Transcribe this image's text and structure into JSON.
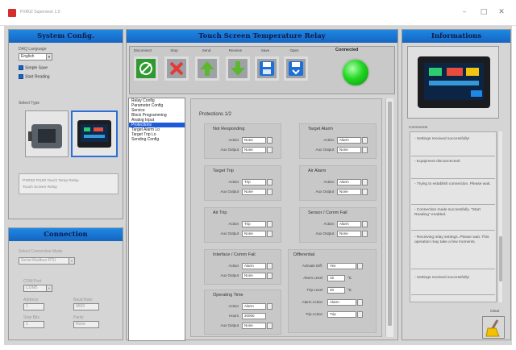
{
  "window": {
    "title": "PXR02 Supervisor 1.0",
    "minimize": "–",
    "maximize": "□",
    "close": "✕"
  },
  "system_config": {
    "header": "System Config.",
    "language_label": "DAQ Language",
    "language_value": "English",
    "simple_save": "Simple Save",
    "start_reading": "Start Reading",
    "select_type_label": "Select Type",
    "device_info_line1": "PXR02 Pt100 Touch Temp Relay",
    "device_info_line2": "Touch Screen Relay"
  },
  "connection": {
    "header": "Connection",
    "com_label": "Select Connection Mode",
    "com_value": "Serial Modbus RTU",
    "port_label": "COM Port",
    "port_value": "COM5",
    "addr_label": "Address",
    "addr_value": "1",
    "baud_label": "Baud Rate",
    "baud_value": "9600",
    "parity_label": "Parity",
    "parity_value": "None",
    "stop_label": "Stop Bits",
    "stop_value": "1"
  },
  "relay": {
    "header": "Touch Screen Temperature Relay",
    "toolbar": [
      {
        "label": "Disconnect"
      },
      {
        "label": "Stop"
      },
      {
        "label": "Send"
      },
      {
        "label": "Receive"
      },
      {
        "label": "Save"
      },
      {
        "label": "Open"
      }
    ],
    "connected_label": "Connected",
    "tree": [
      "Relay Config",
      "Parameter Config",
      "Service",
      "Block Programming",
      "Analog Input",
      "Protections",
      "Target Alarm Lo",
      "Target Trip Lo",
      "Sending Config"
    ],
    "tree_selected_index": 5,
    "section_title": "Protections 1/2",
    "groups": {
      "not_responding": {
        "title": "Not Responding",
        "action_label": "Action",
        "action": "None",
        "aux_label": "Aux Output",
        "aux": "None"
      },
      "target_alarm": {
        "title": "Target Alarm",
        "action_label": "Action",
        "action": "Alarm",
        "aux_label": "Aux Output",
        "aux": "None"
      },
      "target_trip": {
        "title": "Target Trip",
        "action_label": "Action",
        "action": "Trip",
        "aux_label": "Aux Output",
        "aux": "None"
      },
      "air_alarm": {
        "title": "Air Alarm",
        "action_label": "Action",
        "action": "Alarm",
        "aux_label": "Aux Output",
        "aux": "None"
      },
      "air_trip": {
        "title": "Air Trip",
        "action_label": "Action",
        "action": "Trip",
        "aux_label": "Aux Output",
        "aux": "None"
      },
      "sensor_fail": {
        "title": "Sensor / Comm Fail",
        "action_label": "Action",
        "action": "Alarm",
        "aux_label": "Aux Output",
        "aux": "None"
      },
      "interface_fail": {
        "title": "Interface / Comm Fail",
        "action_label": "Action",
        "action": "Alarm",
        "aux_label": "Aux Output",
        "aux": "None"
      },
      "differential": {
        "title": "Differential",
        "activate_label": "Activate Diff.",
        "activate": "Yes",
        "alarm_label": "Alarm Level",
        "alarm": "15",
        "trip_label": "Trip Level",
        "trip": "20",
        "alarm_action_label": "Alarm Action",
        "alarm_action": "Alarm",
        "trip_action_label": "Trip Action",
        "trip_action": "Trip",
        "unit": "°C"
      },
      "operating_time": {
        "title": "Operating Time",
        "action_label": "Action",
        "action": "Alarm",
        "hours_label": "Hours",
        "hours": "20000",
        "aux_label": "Aux Output",
        "aux": "None"
      }
    }
  },
  "informations": {
    "header": "Informations",
    "log_label": "Comments",
    "messages": [
      "- Settings received successfully!",
      "- Equipment disconnected!",
      "- Trying to establish connection. Please wait.",
      "- Connection made successfully. \"Start Reading\" enabled.",
      "- Receiving relay settings. Please wait. This operation may take a few moments.",
      "- Settings received successfully!"
    ],
    "clear_label": "Clear"
  },
  "colors": {
    "header_blue": "#1e88e5",
    "panel_gray": "#d5d5d5",
    "connected_green": "#22d622",
    "selection_blue": "#1e5bd6"
  }
}
